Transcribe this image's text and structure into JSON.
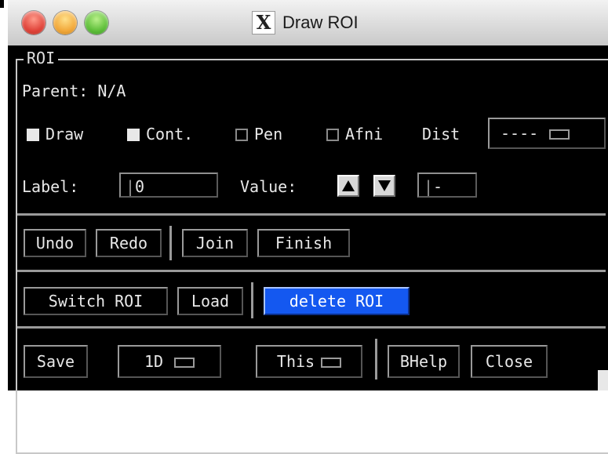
{
  "window": {
    "title": "Draw ROI"
  },
  "roi_panel": {
    "legend": "ROI",
    "parent_text": "Parent: N/A",
    "toggles": [
      {
        "label": "Draw",
        "checked": true
      },
      {
        "label": "Cont.",
        "checked": true
      },
      {
        "label": "Pen",
        "checked": false
      },
      {
        "label": "Afni",
        "checked": false
      }
    ],
    "dist_label": "Dist",
    "dist_value": "----",
    "label_label": "Label:",
    "label_value": "0",
    "value_label": "Value:",
    "value_value": "-"
  },
  "row_edit": {
    "undo": "Undo",
    "redo": "Redo",
    "join": "Join",
    "finish": "Finish"
  },
  "row_roi": {
    "switch": "Switch ROI",
    "load": "Load",
    "delete": "delete ROI"
  },
  "row_bottom": {
    "save": "Save",
    "mode": "1D",
    "scope": "This",
    "bhelp": "BHelp",
    "close": "Close"
  },
  "colors": {
    "active_button": "#1458f0",
    "background": "#000000",
    "text": "#e8e8e8"
  }
}
